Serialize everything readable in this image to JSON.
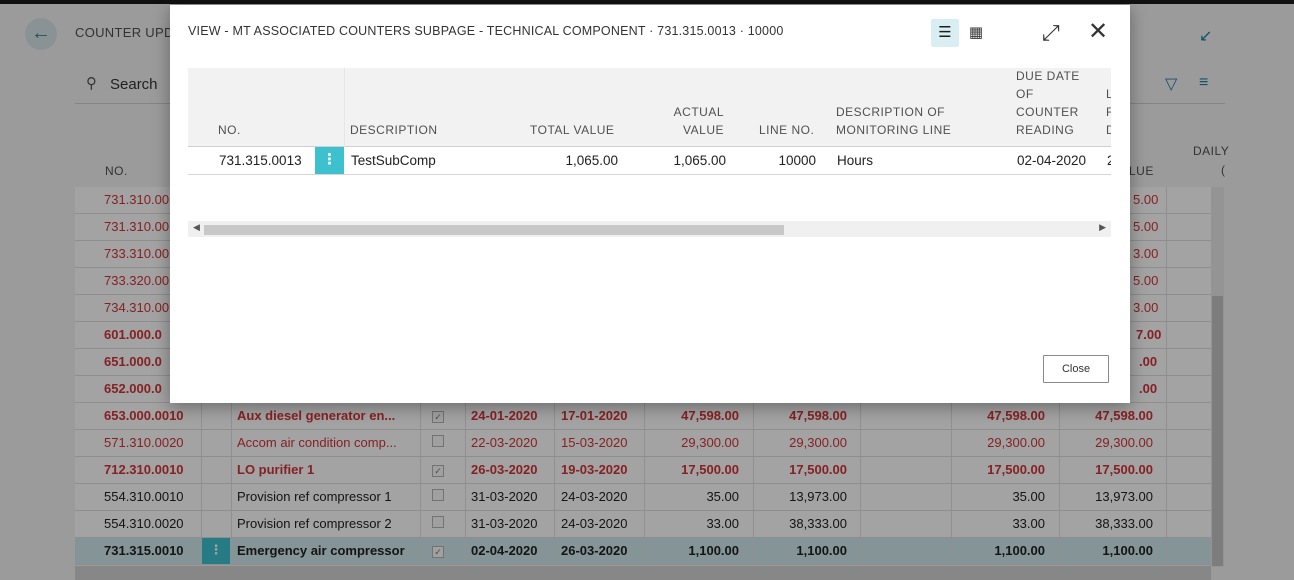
{
  "background": {
    "page_title": "COUNTER UPDA",
    "search_label": "Search",
    "col_no": "NO.",
    "col_daily": "DAILY",
    "col_value_fragment": "LUE",
    "col_c_fragment": "(",
    "rows": [
      {
        "no": "731.310.00",
        "v1": "5.00",
        "red": true,
        "bold": false
      },
      {
        "no": "731.310.00",
        "v1": "5.00",
        "red": true,
        "bold": false
      },
      {
        "no": "733.310.00",
        "v1": "3.00",
        "red": true,
        "bold": false
      },
      {
        "no": "733.320.00",
        "v1": "5.00",
        "red": true,
        "bold": false
      },
      {
        "no": "734.310.00",
        "v1": "3.00",
        "red": true,
        "bold": false
      },
      {
        "no": "601.000.0",
        "v1": "7.00",
        "red": true,
        "bold": true
      },
      {
        "no": "651.000.0",
        "v1": ".00",
        "red": true,
        "bold": true
      },
      {
        "no": "652.000.0",
        "v1": ".00",
        "red": true,
        "bold": true
      }
    ],
    "full_rows": [
      {
        "no": "653.000.0010",
        "desc": "Aux diesel generator en...",
        "checked": true,
        "due": "24-01-2020",
        "last": "17-01-2020",
        "tv": "47,598.00",
        "av": "47,598.00",
        "x1": "47,598.00",
        "x2": "47,598.00",
        "red": true,
        "bold": true,
        "selected": false
      },
      {
        "no": "571.310.0020",
        "desc": "Accom air condition comp...",
        "checked": false,
        "due": "22-03-2020",
        "last": "15-03-2020",
        "tv": "29,300.00",
        "av": "29,300.00",
        "x1": "29,300.00",
        "x2": "29,300.00",
        "red": true,
        "bold": false,
        "selected": false
      },
      {
        "no": "712.310.0010",
        "desc": "LO purifier 1",
        "checked": true,
        "due": "26-03-2020",
        "last": "19-03-2020",
        "tv": "17,500.00",
        "av": "17,500.00",
        "x1": "17,500.00",
        "x2": "17,500.00",
        "red": true,
        "bold": true,
        "selected": false
      },
      {
        "no": "554.310.0010",
        "desc": "Provision ref compressor 1",
        "checked": false,
        "due": "31-03-2020",
        "last": "24-03-2020",
        "tv": "35.00",
        "av": "13,973.00",
        "x1": "35.00",
        "x2": "13,973.00",
        "red": false,
        "bold": false,
        "selected": false
      },
      {
        "no": "554.310.0020",
        "desc": "Provision ref compressor 2",
        "checked": false,
        "due": "31-03-2020",
        "last": "24-03-2020",
        "tv": "33.00",
        "av": "38,333.00",
        "x1": "33.00",
        "x2": "38,333.00",
        "red": false,
        "bold": false,
        "selected": false
      },
      {
        "no": "731.315.0010",
        "desc": "Emergency air compressor",
        "checked": true,
        "due": "02-04-2020",
        "last": "26-03-2020",
        "tv": "1,100.00",
        "av": "1,100.00",
        "x1": "1,100.00",
        "x2": "1,100.00",
        "red": false,
        "bold": true,
        "selected": true
      }
    ]
  },
  "dialog": {
    "title": "VIEW - MT ASSOCIATED COUNTERS SUBPAGE - TECHNICAL COMPONENT · 731.315.0013 · 10000",
    "headers": {
      "no": "NO.",
      "description": "DESCRIPTION",
      "total_value": "TOTAL VALUE",
      "actual_value_1": "ACTUAL",
      "actual_value_2": "VALUE",
      "line_no": "LINE NO.",
      "desc_monitoring_1": "DESCRIPTION OF",
      "desc_monitoring_2": "MONITORING LINE",
      "due_date_1": "DUE DATE",
      "due_date_2": "OF",
      "due_date_3": "COUNTER",
      "due_date_4": "READING",
      "next_1": "L",
      "next_2": "R",
      "next_3": "D"
    },
    "row": {
      "no": "731.315.0013",
      "description": "TestSubComp",
      "total_value": "1,065.00",
      "actual_value": "1,065.00",
      "line_no": "10000",
      "desc_monitoring": "Hours",
      "due_date": "02-04-2020",
      "next_fragment": "2"
    },
    "close_label": "Close"
  }
}
